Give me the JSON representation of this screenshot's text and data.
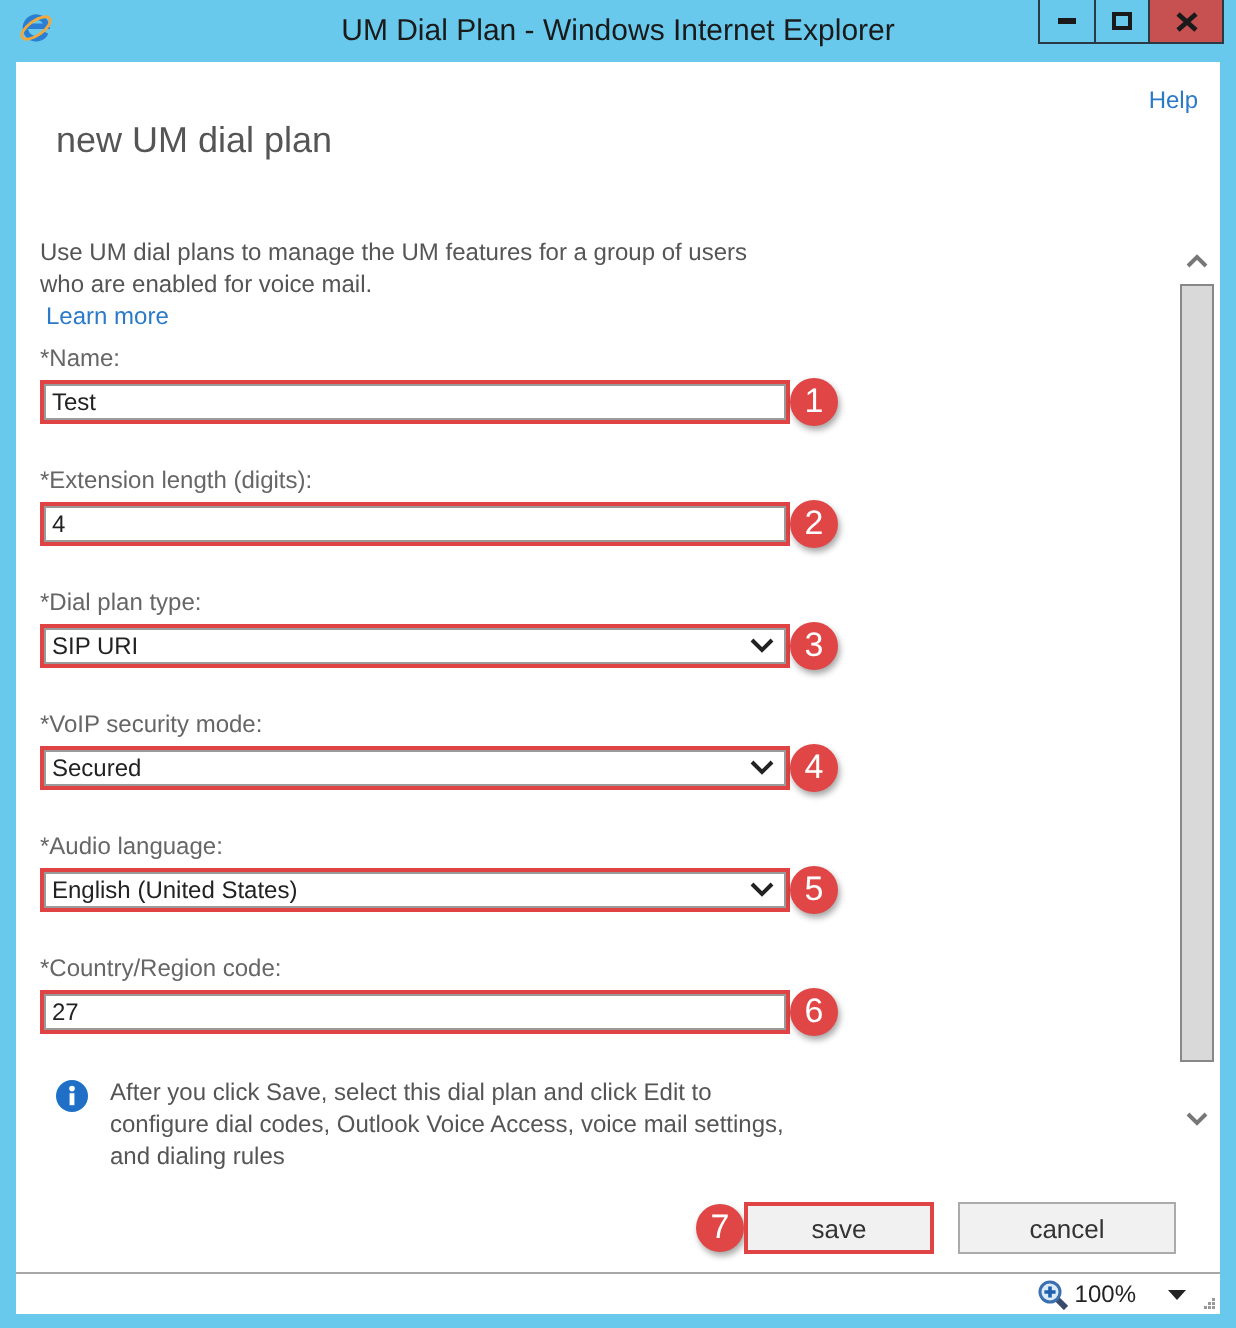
{
  "window": {
    "title": "UM Dial Plan - Windows Internet Explorer"
  },
  "header": {
    "help_link": "Help",
    "title": "new UM dial plan"
  },
  "intro": {
    "text": "Use UM dial plans to manage the UM features for a group of users who are enabled for voice mail.",
    "link": "Learn more"
  },
  "fields": [
    {
      "kind": "text",
      "label": "*Name:",
      "value": "Test",
      "highlighted": true,
      "callout": "1"
    },
    {
      "kind": "text",
      "label": "*Extension length (digits):",
      "value": "4",
      "highlighted": true,
      "callout": "2"
    },
    {
      "kind": "dropdown",
      "label": "*Dial plan type:",
      "value": "SIP URI",
      "highlighted": true,
      "callout": "3"
    },
    {
      "kind": "dropdown",
      "label": "*VoIP security mode:",
      "value": "Secured",
      "highlighted": true,
      "callout": "4"
    },
    {
      "kind": "dropdown",
      "label": "*Audio language:",
      "value": "English (United States)",
      "highlighted": true,
      "callout": "5"
    },
    {
      "kind": "text",
      "label": "*Country/Region code:",
      "value": "27",
      "highlighted": true,
      "callout": "6"
    }
  ],
  "note": {
    "text": "After you click Save, select this dial plan and click Edit to configure dial codes, Outlook Voice Access, voice mail settings, and dialing rules"
  },
  "buttons": [
    {
      "label": "save",
      "highlighted": true,
      "callout": "7"
    },
    {
      "label": "cancel",
      "highlighted": false
    }
  ],
  "status_bar": {
    "zoom": "100%"
  }
}
